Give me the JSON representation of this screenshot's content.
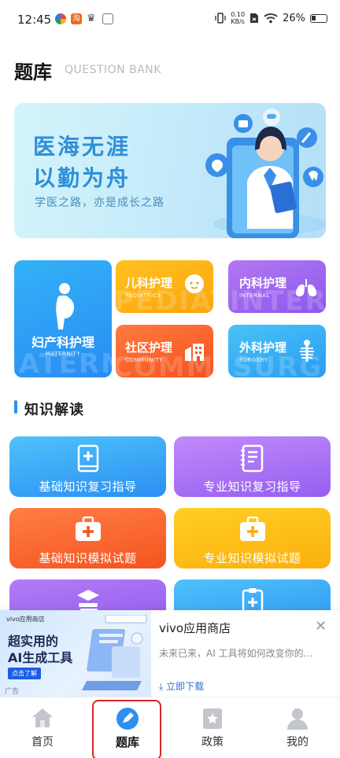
{
  "status_bar": {
    "time": "12:45",
    "net_speed_value": "0.10",
    "net_speed_unit": "KB/s",
    "battery": "26%",
    "left_icons": [
      "app-icon-1",
      "app-icon-2",
      "crown-icon",
      "image-icon"
    ]
  },
  "header": {
    "title": "题库",
    "subtitle": "QUESTION BANK"
  },
  "banner": {
    "line1": "医海无涯",
    "line2": "以勤为舟",
    "tagline": "学医之路，亦是成长之路"
  },
  "categories": [
    {
      "id": "maternity",
      "title": "妇产科护理",
      "subtitle": "MATERNITY",
      "watermark": "MATERNITY"
    },
    {
      "id": "pediatrics",
      "title": "儿科护理",
      "subtitle": "PEDIATRICS",
      "watermark": "PEDIATRICS"
    },
    {
      "id": "internal",
      "title": "内科护理",
      "subtitle": "INTERNAL",
      "watermark": "INTERNAL"
    },
    {
      "id": "community",
      "title": "社区护理",
      "subtitle": "COMMUNITY",
      "watermark": "COMMUNITY"
    },
    {
      "id": "surgery",
      "title": "外科护理",
      "subtitle": "SURGERY",
      "watermark": "SURGERY"
    }
  ],
  "section": {
    "title": "知识解读"
  },
  "knowledge_cards": [
    {
      "id": "basic-review",
      "label": "基础知识复习指导"
    },
    {
      "id": "pro-review",
      "label": "专业知识复习指导"
    },
    {
      "id": "basic-mock",
      "label": "基础知识模拟试题"
    },
    {
      "id": "pro-mock",
      "label": "专业知识模拟试题"
    }
  ],
  "ad": {
    "store_mini": "vivo应用商店",
    "headline_line1": "超实用的",
    "headline_line2": "AI生成工具",
    "cta_mini": "点击了解",
    "ad_mark": "广告",
    "title": "vivo应用商店",
    "description": "未来已来，AI 工具将如何改变你的…",
    "download": "立即下载"
  },
  "tabbar": {
    "items": [
      {
        "id": "home",
        "label": "首页",
        "icon": "home-icon"
      },
      {
        "id": "bank",
        "label": "题库",
        "icon": "pencil-icon",
        "active": true
      },
      {
        "id": "policy",
        "label": "政策",
        "icon": "policy-icon"
      },
      {
        "id": "mine",
        "label": "我的",
        "icon": "user-icon"
      }
    ]
  },
  "colors": {
    "accent": "#2d8ff0",
    "highlight": "#d8262c"
  }
}
